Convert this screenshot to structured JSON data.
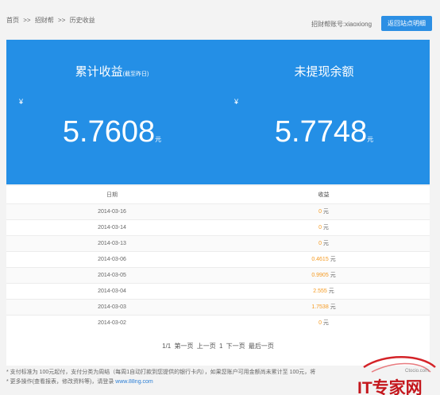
{
  "breadcrumb": {
    "items": [
      "首页",
      ">>",
      "招财帮",
      ">>",
      "历史收益"
    ]
  },
  "header": {
    "account_text": "招财帮账号:xiaoxiong",
    "back_button": "返回站点明细"
  },
  "summary": {
    "left": {
      "title": "累计收益",
      "subtitle": "(截至昨日)",
      "currency": "¥",
      "amount": "5.7608",
      "unit": "元"
    },
    "right": {
      "title": "未提现余额",
      "currency": "¥",
      "amount": "5.7748",
      "unit": "元"
    }
  },
  "table": {
    "headers": [
      "日期",
      "收益"
    ],
    "rows": [
      {
        "date": "2014-03-16",
        "value": "0",
        "unit": "元"
      },
      {
        "date": "2014-03-14",
        "value": "0",
        "unit": "元"
      },
      {
        "date": "2014-03-13",
        "value": "0",
        "unit": "元"
      },
      {
        "date": "2014-03-06",
        "value": "0.4615",
        "unit": "元"
      },
      {
        "date": "2014-03-05",
        "value": "0.9905",
        "unit": "元"
      },
      {
        "date": "2014-03-04",
        "value": "2.555",
        "unit": "元"
      },
      {
        "date": "2014-03-03",
        "value": "1.7538",
        "unit": "元"
      },
      {
        "date": "2014-03-02",
        "value": "0",
        "unit": "元"
      }
    ]
  },
  "pager": {
    "page_info": "1/1",
    "first": "第一页",
    "prev": "上一页",
    "current": "1",
    "next": "下一页",
    "last": "最后一页"
  },
  "notes": {
    "line1": "* 支付标准为 100元起付，支付分类为周结（每周1自动打款到您提供的银行卡内），如果您账户可用金额尚未累计至 100元，将",
    "line2_prefix": "* 更多操作(查看报表，修改资料等)，请登录",
    "line2_link": "www.88ng.com"
  },
  "watermark": {
    "text": "IT专家网",
    "sub": "Ctocio.com"
  },
  "colors": {
    "accent": "#248fe6",
    "income": "#f59b23",
    "button": "#2c8fe4"
  }
}
